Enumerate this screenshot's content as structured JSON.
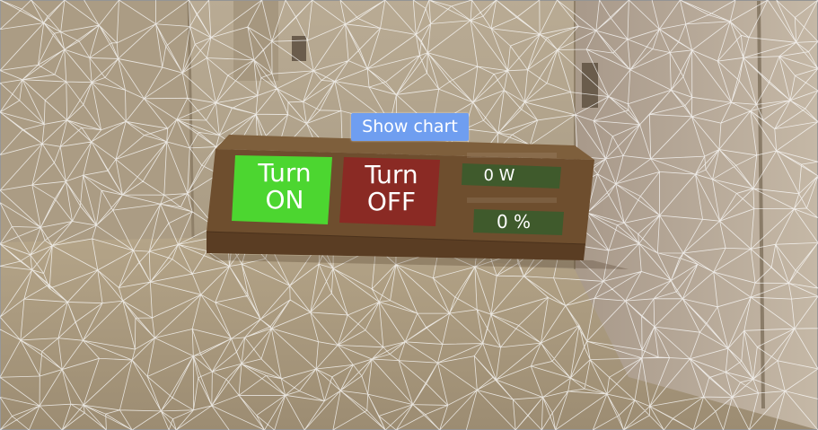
{
  "panel": {
    "show_chart_label": "Show chart",
    "turn_on_label_line1": "Turn",
    "turn_on_label_line2": "ON",
    "turn_off_label_line1": "Turn",
    "turn_off_label_line2": "OFF",
    "power_value": "0 W",
    "percent_value": "0 %"
  },
  "colors": {
    "turn_on": "#4cd630",
    "turn_off": "#8a2a24",
    "readout_bg": "#3f5a2c",
    "panel": "#6e4e2e",
    "show_chart": "#6f9ef0"
  }
}
